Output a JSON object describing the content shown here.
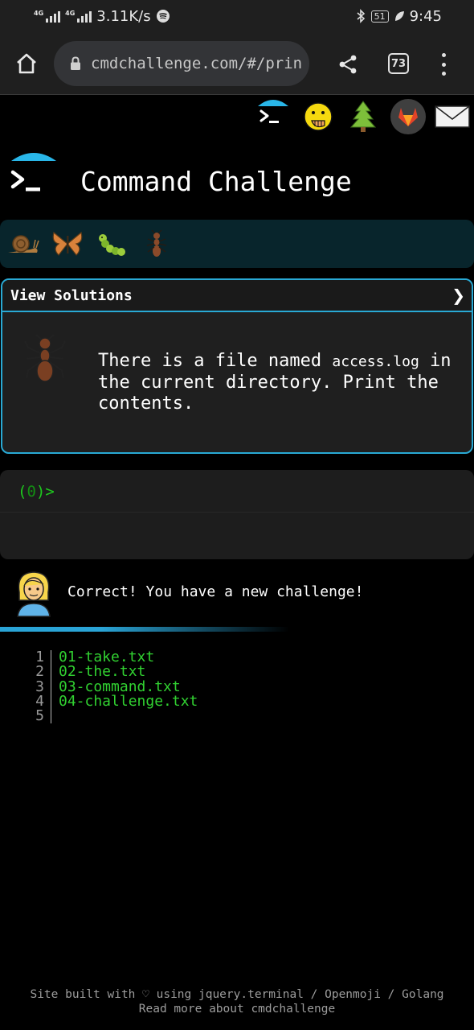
{
  "status_bar": {
    "network_left": "4G",
    "network_right": "4G",
    "speed": "3.11K/s",
    "battery": "51",
    "time": "9:45"
  },
  "browser": {
    "url": "cmdchallenge.com/#/prin",
    "tab_count": "73"
  },
  "top_icons": [
    "terminal-logo-icon",
    "face-with-hand-over-mouth-icon",
    "evergreen-tree-icon",
    "gitlab-icon",
    "envelope-icon"
  ],
  "header": {
    "title": "Command Challenge"
  },
  "levels": [
    "snail-icon",
    "butterfly-icon",
    "caterpillar-icon",
    "ant-icon"
  ],
  "panel": {
    "title": "View Solutions",
    "chevron": "❯",
    "text_before": "There is a file named ",
    "code": "access.log",
    "text_after": " in the current directory. Print the contents."
  },
  "terminal": {
    "prompt_open": "(",
    "prompt_count": "0",
    "prompt_close": ")>"
  },
  "message": {
    "text": "Correct! You have a new challenge!"
  },
  "listing": {
    "numbers": [
      "1",
      "2",
      "3",
      "4",
      "5"
    ],
    "files": [
      "01-take.txt",
      "02-the.txt",
      "03-command.txt",
      "04-challenge.txt",
      ""
    ]
  },
  "footer": {
    "line1": "Site built with ♡ using jquery.terminal / Openmoji / Golang",
    "line2": "Read more about cmdchallenge"
  },
  "colors": {
    "accent": "#29a9d4",
    "prompt_green": "#1ec81e",
    "file_green": "#31d131",
    "level_bar": "#08252c"
  }
}
